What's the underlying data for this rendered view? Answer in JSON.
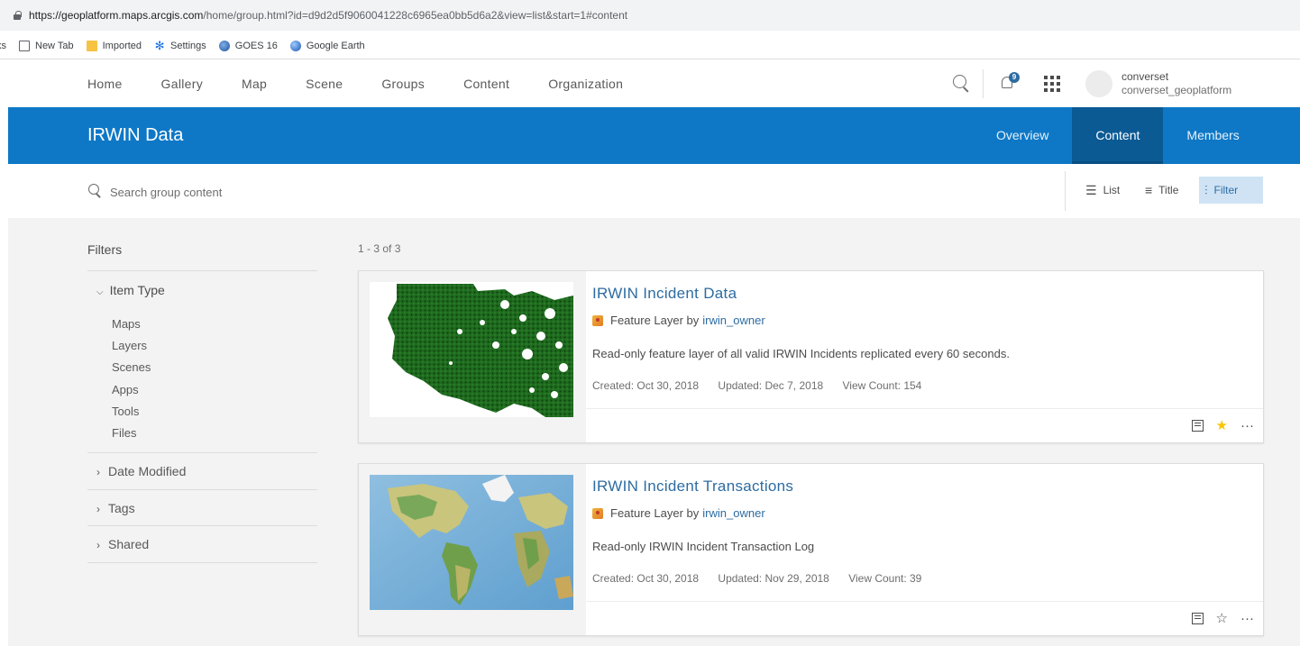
{
  "browser": {
    "url_host": "https://geoplatform.maps.arcgis.com",
    "url_path": "/home/group.html?id=d9d2d5f9060041228c6965ea0bb5d6a2&view=list&start=1#content",
    "bookmarks": [
      {
        "label": "ks",
        "icon": "none"
      },
      {
        "label": "New Tab",
        "icon": "page-icon"
      },
      {
        "label": "Imported",
        "icon": "folder-icon"
      },
      {
        "label": "Settings",
        "icon": "gear-icon"
      },
      {
        "label": "GOES 16",
        "icon": "globe-icon"
      },
      {
        "label": "Google Earth",
        "icon": "earth-icon"
      }
    ]
  },
  "topnav": {
    "links": [
      "Home",
      "Gallery",
      "Map",
      "Scene",
      "Groups",
      "Content",
      "Organization"
    ],
    "notification_count": "9",
    "user_name": "converset",
    "user_org": "converset_geoplatform"
  },
  "group": {
    "title": "IRWIN Data",
    "tabs": [
      {
        "label": "Overview",
        "active": false
      },
      {
        "label": "Content",
        "active": true
      },
      {
        "label": "Members",
        "active": false
      }
    ]
  },
  "search": {
    "placeholder": "Search group content"
  },
  "view_buttons": {
    "list": "List",
    "title": "Title",
    "filter": "Filter"
  },
  "filters": {
    "heading": "Filters",
    "item_type_label": "Item Type",
    "item_types": [
      "Maps",
      "Layers",
      "Scenes",
      "Apps",
      "Tools",
      "Files"
    ],
    "date_modified": "Date Modified",
    "tags": "Tags",
    "shared": "Shared"
  },
  "results": {
    "count": "1 - 3 of 3",
    "items": [
      {
        "title": "IRWIN Incident Data",
        "type": "Feature Layer by",
        "owner": "irwin_owner",
        "description": "Read-only feature layer of all valid IRWIN Incidents replicated every 60 seconds.",
        "created": "Created: Oct 30, 2018",
        "updated": "Updated: Dec 7, 2018",
        "views": "View Count: 154",
        "favorite": true
      },
      {
        "title": "IRWIN Incident Transactions",
        "type": "Feature Layer by",
        "owner": "irwin_owner",
        "description": "Read-only IRWIN Incident Transaction Log",
        "created": "Created: Oct 30, 2018",
        "updated": "Updated: Nov 29, 2018",
        "views": "View Count: 39",
        "favorite": false
      }
    ]
  },
  "colors": {
    "brand_blue": "#0e78c6",
    "active_tab": "#0b5a94",
    "link_blue": "#2d6ca2",
    "favorite_star": "#f6c700"
  }
}
